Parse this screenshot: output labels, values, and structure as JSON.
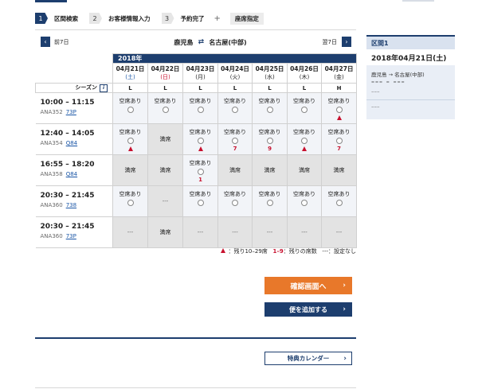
{
  "steps": [
    {
      "num": "1",
      "label": "区間検索",
      "active": true
    },
    {
      "num": "2",
      "label": "お客様情報入力",
      "active": false
    },
    {
      "num": "3",
      "label": "予約完了",
      "active": false
    }
  ],
  "steps_plus": "+",
  "seat_selection_label": "座席指定",
  "route": {
    "prev_label": "前7日",
    "next_label": "翌7日",
    "origin": "鹿児島",
    "destination": "名古屋(中部)",
    "prev_icon": "chevron-left-icon",
    "next_icon": "chevron-right-icon",
    "swap_icon": "swap-icon"
  },
  "calendar": {
    "year": "2018年",
    "dates": [
      {
        "date": "04月21日",
        "dow": "(土)",
        "type": "sat",
        "fare": "L"
      },
      {
        "date": "04月22日",
        "dow": "(日)",
        "type": "hol",
        "fare": "L"
      },
      {
        "date": "04月23日",
        "dow": "(月)",
        "type": "",
        "fare": "L"
      },
      {
        "date": "04月24日",
        "dow": "(火)",
        "type": "",
        "fare": "L"
      },
      {
        "date": "04月25日",
        "dow": "(水)",
        "type": "",
        "fare": "L"
      },
      {
        "date": "04月26日",
        "dow": "(木)",
        "type": "",
        "fare": "L"
      },
      {
        "date": "04月27日",
        "dow": "(金)",
        "type": "",
        "fare": "H"
      }
    ],
    "season_label": "シーズン",
    "help_icon": "i",
    "flights": [
      {
        "time": "10:00 – 11:15",
        "airline": "ANA352",
        "aircraft": "73P",
        "cells": [
          {
            "status": "空席あり",
            "kind": "open",
            "mark": ""
          },
          {
            "status": "空席あり",
            "kind": "open",
            "mark": ""
          },
          {
            "status": "空席あり",
            "kind": "open",
            "mark": ""
          },
          {
            "status": "空席あり",
            "kind": "open",
            "mark": ""
          },
          {
            "status": "空席あり",
            "kind": "open",
            "mark": ""
          },
          {
            "status": "空席あり",
            "kind": "open",
            "mark": ""
          },
          {
            "status": "空席あり",
            "kind": "open",
            "mark": "tri"
          }
        ]
      },
      {
        "time": "12:40 – 14:05",
        "airline": "ANA354",
        "aircraft": "Q84",
        "cells": [
          {
            "status": "空席あり",
            "kind": "open",
            "mark": "tri"
          },
          {
            "status": "満席",
            "kind": "full",
            "mark": ""
          },
          {
            "status": "空席あり",
            "kind": "open",
            "mark": "tri"
          },
          {
            "status": "空席あり",
            "kind": "open",
            "mark": "7"
          },
          {
            "status": "空席あり",
            "kind": "open",
            "mark": "9"
          },
          {
            "status": "空席あり",
            "kind": "open",
            "mark": "tri"
          },
          {
            "status": "空席あり",
            "kind": "open",
            "mark": "7"
          }
        ]
      },
      {
        "time": "16:55 – 18:20",
        "airline": "ANA358",
        "aircraft": "Q84",
        "cells": [
          {
            "status": "満席",
            "kind": "full",
            "mark": ""
          },
          {
            "status": "満席",
            "kind": "full",
            "mark": ""
          },
          {
            "status": "空席あり",
            "kind": "open",
            "mark": "1"
          },
          {
            "status": "満席",
            "kind": "full",
            "mark": ""
          },
          {
            "status": "満席",
            "kind": "full",
            "mark": ""
          },
          {
            "status": "満席",
            "kind": "full",
            "mark": ""
          },
          {
            "status": "満席",
            "kind": "full",
            "mark": ""
          }
        ]
      },
      {
        "time": "20:30 – 21:45",
        "airline": "ANA360",
        "aircraft": "738",
        "cells": [
          {
            "status": "空席あり",
            "kind": "open",
            "mark": ""
          },
          {
            "status": "---",
            "kind": "none",
            "mark": ""
          },
          {
            "status": "空席あり",
            "kind": "open",
            "mark": ""
          },
          {
            "status": "空席あり",
            "kind": "open",
            "mark": ""
          },
          {
            "status": "空席あり",
            "kind": "open",
            "mark": ""
          },
          {
            "status": "空席あり",
            "kind": "open",
            "mark": ""
          },
          {
            "status": "空席あり",
            "kind": "open",
            "mark": ""
          }
        ]
      },
      {
        "time": "20:30 – 21:45",
        "airline": "ANA360",
        "aircraft": "73P",
        "cells": [
          {
            "status": "---",
            "kind": "none",
            "mark": ""
          },
          {
            "status": "満席",
            "kind": "full",
            "mark": ""
          },
          {
            "status": "---",
            "kind": "none",
            "mark": ""
          },
          {
            "status": "---",
            "kind": "none",
            "mark": ""
          },
          {
            "status": "---",
            "kind": "none",
            "mark": ""
          },
          {
            "status": "---",
            "kind": "none",
            "mark": ""
          },
          {
            "status": "---",
            "kind": "none",
            "mark": ""
          }
        ]
      }
    ]
  },
  "legend": {
    "few_seats": "：残り10–29席",
    "count_range": "1–9",
    "count_label": "：残りの席数",
    "none_mark": "---",
    "none_label": "：設定なし"
  },
  "buttons": {
    "confirm": "確認画面へ",
    "add_flight": "便を追加する",
    "award_calendar": "特典カレンダー"
  },
  "sidebar": {
    "section": "区間1",
    "date": "2018年04月21日(土)",
    "origin": "鹿児島",
    "arrow": "→",
    "destination": "名古屋(中部)",
    "times": "––– – –––",
    "line1": "–––",
    "line2": "–––"
  },
  "colors": {
    "brand_navy": "#1d3e6e",
    "accent_orange": "#e8782a",
    "alert_red": "#c8102e"
  }
}
